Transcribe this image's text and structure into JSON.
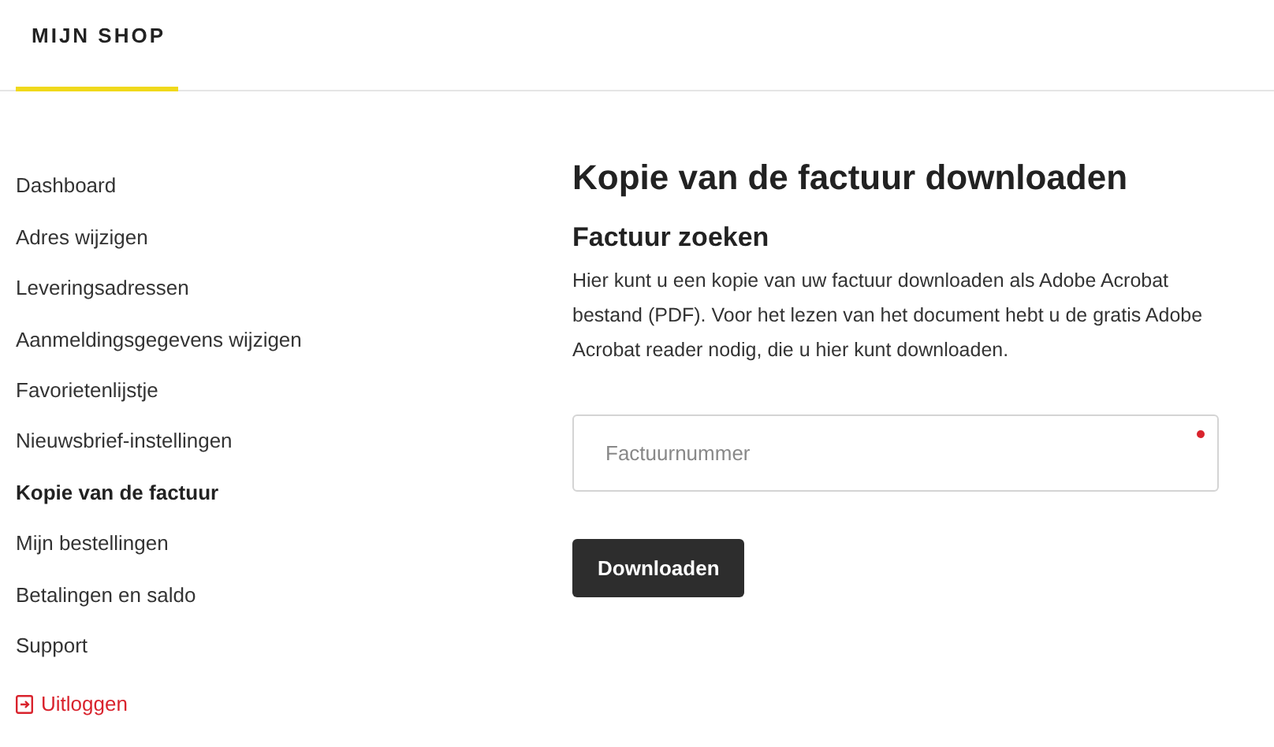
{
  "tabs": [
    {
      "label": "MIJN SHOP",
      "selected": true
    }
  ],
  "sidebar": {
    "items": [
      {
        "label": "Dashboard",
        "selected": false,
        "kind": "link"
      },
      {
        "label": "Adres wijzigen",
        "selected": false,
        "kind": "link"
      },
      {
        "label": "Leveringsadressen",
        "selected": false,
        "kind": "link"
      },
      {
        "label": "Aanmeldingsgegevens wijzigen",
        "selected": false,
        "kind": "link"
      },
      {
        "label": "Favorietenlijstje",
        "selected": false,
        "kind": "link"
      },
      {
        "label": "Nieuwsbrief-instellingen",
        "selected": false,
        "kind": "link"
      },
      {
        "label": "Kopie van de factuur",
        "selected": true,
        "kind": "link"
      },
      {
        "label": "Mijn bestellingen",
        "selected": false,
        "kind": "link"
      },
      {
        "label": "Betalingen en saldo",
        "selected": false,
        "kind": "link"
      },
      {
        "label": "Support",
        "selected": false,
        "kind": "link"
      },
      {
        "label": "Uitloggen",
        "selected": false,
        "kind": "logout"
      }
    ]
  },
  "main": {
    "title": "Kopie van de factuur downloaden",
    "subtitle": "Factuur zoeken",
    "description": "Hier kunt u een kopie van uw factuur downloaden als Adobe Acrobat bestand (PDF). Voor het lezen van het document hebt u de gratis Adobe Acrobat reader nodig, die u hier kunt downloaden.",
    "field": {
      "placeholder": "Factuurnummer",
      "required": true
    },
    "button": "Downloaden"
  }
}
